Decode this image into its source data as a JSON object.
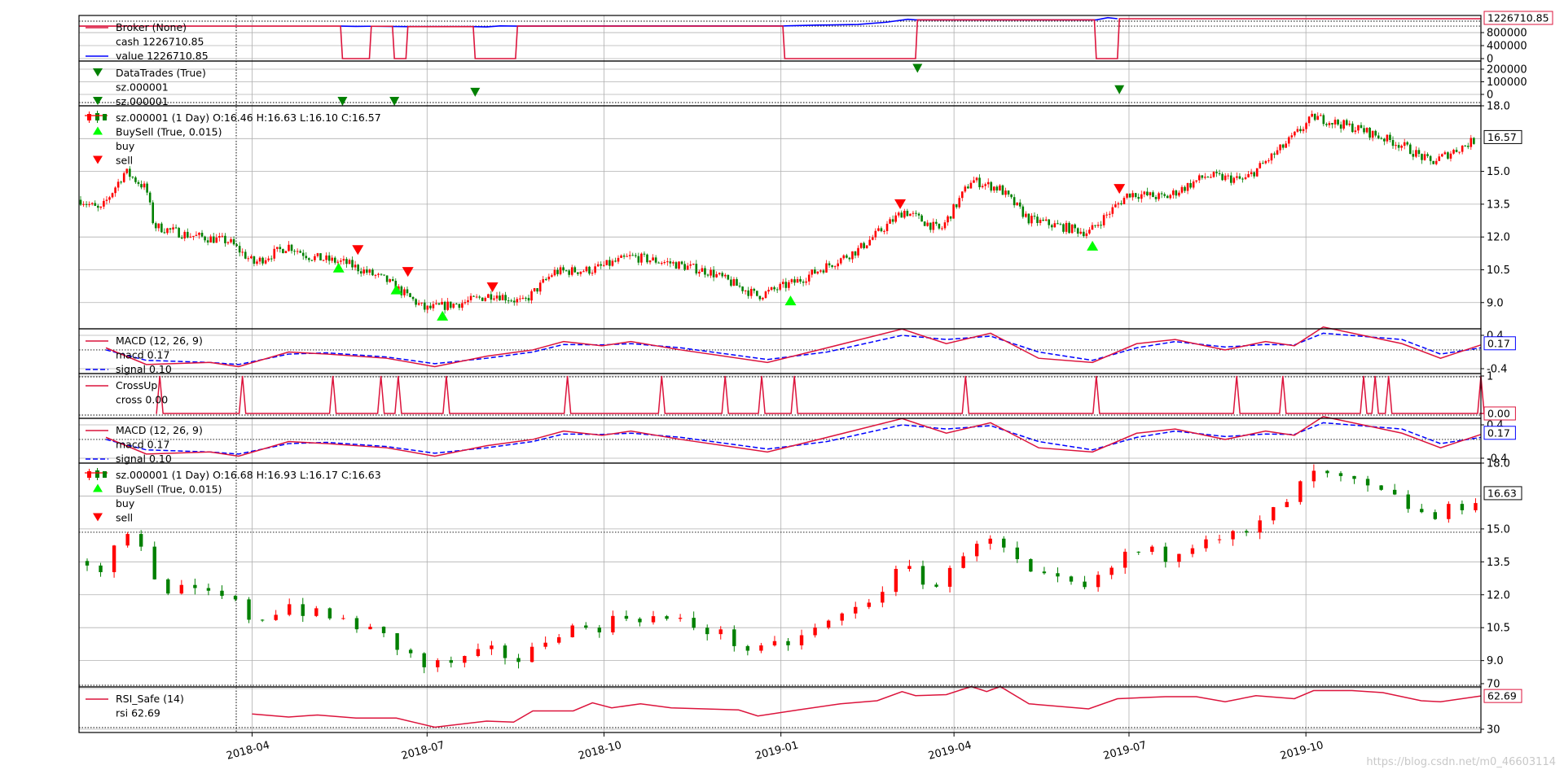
{
  "watermark": "https://blog.csdn.net/m0_46603114",
  "x_axis": {
    "ticks": [
      "2018-04",
      "2018-07",
      "2018-10",
      "2019-01",
      "2019-04",
      "2019-07",
      "2019-10"
    ]
  },
  "chart_data": [
    {
      "panel": "broker",
      "type": "line",
      "legend": [
        "Broker (None)",
        "cash 1226710.85",
        "value 1226710.85"
      ],
      "ylim": [
        0,
        1226710.85
      ],
      "y_ticks": [
        "800000",
        "400000",
        "0"
      ],
      "last_value_label": "1226710.85",
      "colors": {
        "cash": "#dc143c",
        "value": "#0000ff"
      },
      "cash_segments": [
        {
          "x": "2018-01-01",
          "y": 1000000
        },
        {
          "x": "2018-05-17",
          "y": 1000000
        },
        {
          "x": "2018-05-18",
          "y": 0
        },
        {
          "x": "2018-06-01",
          "y": 0
        },
        {
          "x": "2018-06-02",
          "y": 995000
        },
        {
          "x": "2018-06-13",
          "y": 995000
        },
        {
          "x": "2018-06-14",
          "y": 0
        },
        {
          "x": "2018-06-20",
          "y": 0
        },
        {
          "x": "2018-06-21",
          "y": 985000
        },
        {
          "x": "2018-07-25",
          "y": 985000
        },
        {
          "x": "2018-07-26",
          "y": 0
        },
        {
          "x": "2018-08-16",
          "y": 0
        },
        {
          "x": "2018-08-17",
          "y": 1000000
        },
        {
          "x": "2019-01-02",
          "y": 1000000
        },
        {
          "x": "2019-01-03",
          "y": 0
        },
        {
          "x": "2019-03-12",
          "y": 0
        },
        {
          "x": "2019-03-13",
          "y": 1190000
        },
        {
          "x": "2019-06-13",
          "y": 1190000
        },
        {
          "x": "2019-06-14",
          "y": 0
        },
        {
          "x": "2019-06-25",
          "y": 0
        },
        {
          "x": "2019-06-26",
          "y": 1226710.85
        },
        {
          "x": "2019-12-31",
          "y": 1226710.85
        }
      ],
      "value_points": [
        {
          "x": "2018-05-17",
          "y": 1000000
        },
        {
          "x": "2018-05-25",
          "y": 990000
        },
        {
          "x": "2018-06-01",
          "y": 995000
        },
        {
          "x": "2018-06-20",
          "y": 985000
        },
        {
          "x": "2018-07-25",
          "y": 985000
        },
        {
          "x": "2018-08-01",
          "y": 975000
        },
        {
          "x": "2018-08-08",
          "y": 1005000
        },
        {
          "x": "2018-08-16",
          "y": 1000000
        },
        {
          "x": "2019-01-03",
          "y": 1005000
        },
        {
          "x": "2019-01-20",
          "y": 1030000
        },
        {
          "x": "2019-02-10",
          "y": 1050000
        },
        {
          "x": "2019-02-25",
          "y": 1120000
        },
        {
          "x": "2019-03-08",
          "y": 1210000
        },
        {
          "x": "2019-03-12",
          "y": 1190000
        },
        {
          "x": "2019-06-14",
          "y": 1190000
        },
        {
          "x": "2019-06-20",
          "y": 1260000
        },
        {
          "x": "2019-06-25",
          "y": 1226710.85
        }
      ]
    },
    {
      "panel": "trades",
      "type": "scatter",
      "legend": [
        "DataTrades (True)",
        "sz.000001",
        "sz.000001"
      ],
      "y_ticks": [
        "200000",
        "100000",
        "0"
      ],
      "points": [
        {
          "x": "2018-05-18",
          "y": -60000,
          "color": "#008000"
        },
        {
          "x": "2018-06-14",
          "y": -60000,
          "color": "#008000"
        },
        {
          "x": "2018-07-26",
          "y": 20000,
          "color": "#008000"
        },
        {
          "x": "2019-03-13",
          "y": 210000,
          "color": "#008000"
        },
        {
          "x": "2019-06-26",
          "y": 40000,
          "color": "#008000"
        }
      ]
    },
    {
      "panel": "price_main",
      "type": "candlestick",
      "legend": [
        "sz.000001 (1 Day) O:16.46 H:16.63 L:16.10 C:16.57",
        "BuySell (True, 0.015)",
        "buy",
        "sell"
      ],
      "ylim": [
        7.8,
        18.0
      ],
      "y_ticks": [
        18.0,
        15.0,
        13.5,
        12.0,
        10.5,
        9.0
      ],
      "last_value_label": "16.57",
      "anchor_closes": [
        {
          "x": "2018-01-02",
          "y": 13.7
        },
        {
          "x": "2018-01-12",
          "y": 13.2
        },
        {
          "x": "2018-01-25",
          "y": 15.0
        },
        {
          "x": "2018-02-05",
          "y": 14.2
        },
        {
          "x": "2018-02-09",
          "y": 12.5
        },
        {
          "x": "2018-02-26",
          "y": 12.1
        },
        {
          "x": "2018-03-20",
          "y": 11.8
        },
        {
          "x": "2018-04-02",
          "y": 10.8
        },
        {
          "x": "2018-04-20",
          "y": 11.6
        },
        {
          "x": "2018-05-01",
          "y": 11.1
        },
        {
          "x": "2018-05-20",
          "y": 10.8
        },
        {
          "x": "2018-06-10",
          "y": 10.0
        },
        {
          "x": "2018-06-30",
          "y": 8.7
        },
        {
          "x": "2018-07-20",
          "y": 9.0
        },
        {
          "x": "2018-08-05",
          "y": 9.4
        },
        {
          "x": "2018-08-20",
          "y": 9.0
        },
        {
          "x": "2018-09-05",
          "y": 10.4
        },
        {
          "x": "2018-09-25",
          "y": 10.5
        },
        {
          "x": "2018-10-15",
          "y": 11.1
        },
        {
          "x": "2018-11-05",
          "y": 10.8
        },
        {
          "x": "2018-11-25",
          "y": 10.4
        },
        {
          "x": "2018-12-20",
          "y": 9.3
        },
        {
          "x": "2019-01-10",
          "y": 10.0
        },
        {
          "x": "2019-02-10",
          "y": 11.4
        },
        {
          "x": "2019-03-06",
          "y": 13.2
        },
        {
          "x": "2019-03-25",
          "y": 12.3
        },
        {
          "x": "2019-04-10",
          "y": 14.6
        },
        {
          "x": "2019-04-25",
          "y": 14.2
        },
        {
          "x": "2019-05-10",
          "y": 12.8
        },
        {
          "x": "2019-06-10",
          "y": 12.2
        },
        {
          "x": "2019-07-01",
          "y": 14.0
        },
        {
          "x": "2019-07-20",
          "y": 13.8
        },
        {
          "x": "2019-08-10",
          "y": 14.8
        },
        {
          "x": "2019-08-30",
          "y": 14.6
        },
        {
          "x": "2019-09-20",
          "y": 16.2
        },
        {
          "x": "2019-10-05",
          "y": 17.5
        },
        {
          "x": "2019-10-30",
          "y": 16.9
        },
        {
          "x": "2019-11-20",
          "y": 16.2
        },
        {
          "x": "2019-12-05",
          "y": 15.4
        },
        {
          "x": "2019-12-31",
          "y": 16.57
        }
      ],
      "buy_markers": [
        {
          "x": "2018-05-16",
          "y": 10.6
        },
        {
          "x": "2018-06-15",
          "y": 9.6
        },
        {
          "x": "2018-07-09",
          "y": 8.4
        },
        {
          "x": "2019-01-06",
          "y": 9.1
        },
        {
          "x": "2019-06-12",
          "y": 11.6
        }
      ],
      "sell_markers": [
        {
          "x": "2018-05-26",
          "y": 11.4
        },
        {
          "x": "2018-06-21",
          "y": 10.4
        },
        {
          "x": "2018-08-04",
          "y": 9.7
        },
        {
          "x": "2019-03-04",
          "y": 13.5
        },
        {
          "x": "2019-06-26",
          "y": 14.2
        }
      ],
      "colors": {
        "up": "#ff0000",
        "down": "#008000",
        "buy": "#00ff00",
        "sell": "#ff0000"
      }
    },
    {
      "panel": "macd_1",
      "type": "line",
      "legend": [
        "MACD (12, 26, 9)",
        "macd 0.17",
        "signal 0.10"
      ],
      "y_ticks": [
        "0.4",
        "-0.4"
      ],
      "last_value_label": "0.17",
      "macd": [
        {
          "x": "2018-01-15",
          "y": 0.1
        },
        {
          "x": "2018-02-05",
          "y": -0.3
        },
        {
          "x": "2018-03-10",
          "y": -0.25
        },
        {
          "x": "2018-03-25",
          "y": -0.35
        },
        {
          "x": "2018-04-20",
          "y": 0.0
        },
        {
          "x": "2018-05-10",
          "y": -0.05
        },
        {
          "x": "2018-06-10",
          "y": -0.15
        },
        {
          "x": "2018-07-05",
          "y": -0.35
        },
        {
          "x": "2018-08-01",
          "y": -0.1
        },
        {
          "x": "2018-08-25",
          "y": 0.05
        },
        {
          "x": "2018-09-10",
          "y": 0.25
        },
        {
          "x": "2018-09-30",
          "y": 0.15
        },
        {
          "x": "2018-10-15",
          "y": 0.25
        },
        {
          "x": "2018-11-10",
          "y": 0.05
        },
        {
          "x": "2018-12-25",
          "y": -0.25
        },
        {
          "x": "2019-01-25",
          "y": 0.1
        },
        {
          "x": "2019-03-05",
          "y": 0.55
        },
        {
          "x": "2019-03-28",
          "y": 0.2
        },
        {
          "x": "2019-04-20",
          "y": 0.45
        },
        {
          "x": "2019-05-15",
          "y": -0.15
        },
        {
          "x": "2019-06-12",
          "y": -0.25
        },
        {
          "x": "2019-07-05",
          "y": 0.2
        },
        {
          "x": "2019-07-25",
          "y": 0.3
        },
        {
          "x": "2019-08-20",
          "y": 0.05
        },
        {
          "x": "2019-09-10",
          "y": 0.25
        },
        {
          "x": "2019-09-25",
          "y": 0.15
        },
        {
          "x": "2019-10-10",
          "y": 0.6
        },
        {
          "x": "2019-11-20",
          "y": 0.2
        },
        {
          "x": "2019-12-10",
          "y": -0.15
        },
        {
          "x": "2019-12-31",
          "y": 0.17
        }
      ],
      "signal": [
        {
          "x": "2018-01-15",
          "y": 0.05
        },
        {
          "x": "2018-02-05",
          "y": -0.2
        },
        {
          "x": "2018-03-10",
          "y": -0.25
        },
        {
          "x": "2018-03-25",
          "y": -0.3
        },
        {
          "x": "2018-04-20",
          "y": -0.05
        },
        {
          "x": "2018-05-10",
          "y": -0.02
        },
        {
          "x": "2018-06-10",
          "y": -0.12
        },
        {
          "x": "2018-07-05",
          "y": -0.28
        },
        {
          "x": "2018-08-01",
          "y": -0.15
        },
        {
          "x": "2018-08-25",
          "y": 0.0
        },
        {
          "x": "2018-09-10",
          "y": 0.18
        },
        {
          "x": "2018-09-30",
          "y": 0.17
        },
        {
          "x": "2018-10-15",
          "y": 0.2
        },
        {
          "x": "2018-11-10",
          "y": 0.1
        },
        {
          "x": "2018-12-25",
          "y": -0.18
        },
        {
          "x": "2019-01-25",
          "y": 0.0
        },
        {
          "x": "2019-03-05",
          "y": 0.4
        },
        {
          "x": "2019-03-28",
          "y": 0.3
        },
        {
          "x": "2019-04-20",
          "y": 0.38
        },
        {
          "x": "2019-05-15",
          "y": 0.0
        },
        {
          "x": "2019-06-12",
          "y": -0.2
        },
        {
          "x": "2019-07-05",
          "y": 0.1
        },
        {
          "x": "2019-07-25",
          "y": 0.25
        },
        {
          "x": "2019-08-20",
          "y": 0.12
        },
        {
          "x": "2019-09-10",
          "y": 0.18
        },
        {
          "x": "2019-09-25",
          "y": 0.17
        },
        {
          "x": "2019-10-10",
          "y": 0.45
        },
        {
          "x": "2019-11-20",
          "y": 0.3
        },
        {
          "x": "2019-12-10",
          "y": -0.05
        },
        {
          "x": "2019-12-31",
          "y": 0.1
        }
      ]
    },
    {
      "panel": "crossup",
      "type": "line",
      "legend": [
        "CrossUp",
        "cross 0.00"
      ],
      "y_ticks": [
        "1"
      ],
      "last_value_label": "0.00",
      "spikes": [
        "2018-02-12",
        "2018-03-27",
        "2018-05-13",
        "2018-06-07",
        "2018-06-16",
        "2018-07-11",
        "2018-09-12",
        "2018-10-31",
        "2018-12-03",
        "2018-12-22",
        "2019-01-08",
        "2019-04-07",
        "2019-06-14",
        "2019-08-26",
        "2019-09-19",
        "2019-10-31",
        "2019-11-06",
        "2019-11-13",
        "2019-12-31"
      ]
    },
    {
      "panel": "macd_2",
      "type": "line",
      "legend": [
        "MACD (12, 26, 9)",
        "macd 0.17",
        "signal 0.10"
      ],
      "y_ticks": [
        "0.4",
        "-0.4"
      ],
      "last_value_label": "0.17"
    },
    {
      "panel": "price_weekly",
      "type": "candlestick",
      "legend": [
        "sz.000001 (1 Day) O:16.68 H:16.93 L:16.17 C:16.63",
        "BuySell (True, 0.015)",
        "buy",
        "sell"
      ],
      "ylim": [
        7.8,
        18.0
      ],
      "y_ticks": [
        18.0,
        15.0,
        13.5,
        12.0,
        10.5,
        9.0
      ],
      "last_value_label": "16.63"
    },
    {
      "panel": "rsi",
      "type": "line",
      "legend": [
        "RSI_Safe (14)",
        "rsi 62.69"
      ],
      "y_ticks": [
        "70",
        "30"
      ],
      "last_value_label": "62.69",
      "color": "#dc143c",
      "values": [
        {
          "x": "2018-04-01",
          "y": 45
        },
        {
          "x": "2018-04-20",
          "y": 42
        },
        {
          "x": "2018-05-05",
          "y": 44
        },
        {
          "x": "2018-05-25",
          "y": 41
        },
        {
          "x": "2018-06-15",
          "y": 41
        },
        {
          "x": "2018-07-05",
          "y": 32
        },
        {
          "x": "2018-08-01",
          "y": 38
        },
        {
          "x": "2018-08-15",
          "y": 37
        },
        {
          "x": "2018-08-25",
          "y": 48
        },
        {
          "x": "2018-09-15",
          "y": 48
        },
        {
          "x": "2018-09-25",
          "y": 56
        },
        {
          "x": "2018-10-05",
          "y": 51
        },
        {
          "x": "2018-10-20",
          "y": 55
        },
        {
          "x": "2018-11-05",
          "y": 51
        },
        {
          "x": "2018-12-10",
          "y": 49
        },
        {
          "x": "2018-12-20",
          "y": 43
        },
        {
          "x": "2019-01-10",
          "y": 49
        },
        {
          "x": "2019-02-01",
          "y": 55
        },
        {
          "x": "2019-02-20",
          "y": 58
        },
        {
          "x": "2019-03-05",
          "y": 67
        },
        {
          "x": "2019-03-12",
          "y": 63
        },
        {
          "x": "2019-03-28",
          "y": 64
        },
        {
          "x": "2019-04-10",
          "y": 72
        },
        {
          "x": "2019-04-18",
          "y": 67
        },
        {
          "x": "2019-04-25",
          "y": 72
        },
        {
          "x": "2019-05-10",
          "y": 55
        },
        {
          "x": "2019-06-10",
          "y": 50
        },
        {
          "x": "2019-06-25",
          "y": 60
        },
        {
          "x": "2019-07-20",
          "y": 62
        },
        {
          "x": "2019-08-05",
          "y": 62
        },
        {
          "x": "2019-08-20",
          "y": 57
        },
        {
          "x": "2019-09-05",
          "y": 63
        },
        {
          "x": "2019-09-25",
          "y": 60
        },
        {
          "x": "2019-10-05",
          "y": 68
        },
        {
          "x": "2019-10-25",
          "y": 68
        },
        {
          "x": "2019-11-10",
          "y": 66
        },
        {
          "x": "2019-11-30",
          "y": 58
        },
        {
          "x": "2019-12-10",
          "y": 57
        },
        {
          "x": "2019-12-31",
          "y": 62.69
        }
      ]
    }
  ]
}
